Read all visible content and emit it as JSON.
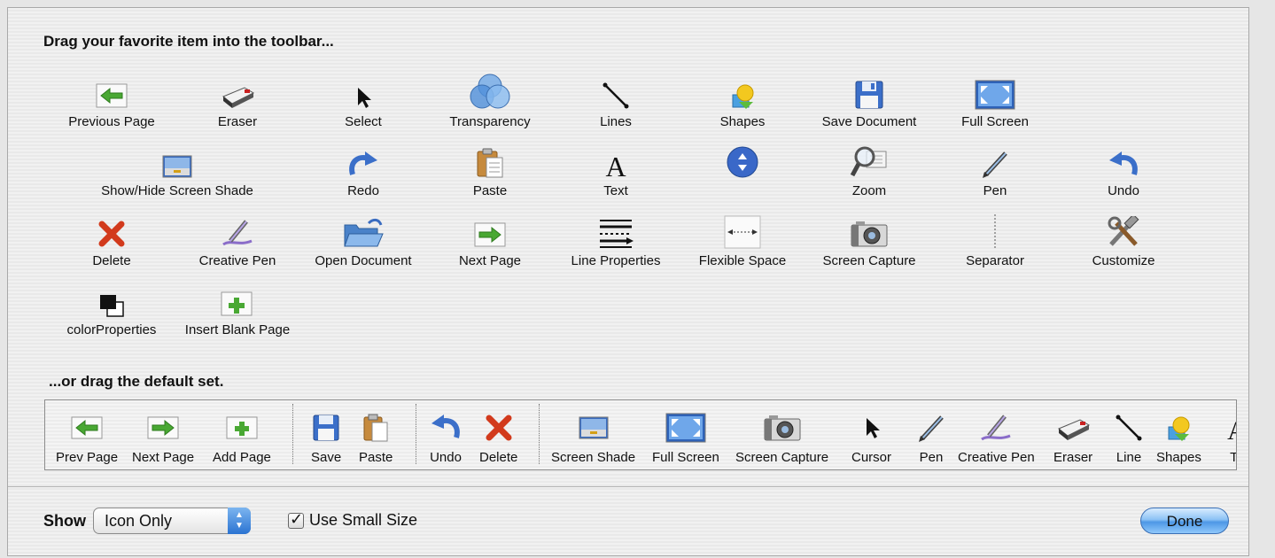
{
  "header": "Drag your favorite item into the toolbar...",
  "items": [
    {
      "label": "Previous Page",
      "icon": "previous-page-icon"
    },
    {
      "label": "Eraser",
      "icon": "eraser-icon"
    },
    {
      "label": "Select",
      "icon": "select-arrow-icon"
    },
    {
      "label": "Transparency",
      "icon": "transparency-icon"
    },
    {
      "label": "Lines",
      "icon": "line-icon"
    },
    {
      "label": "Shapes",
      "icon": "shapes-icon"
    },
    {
      "label": "Save Document",
      "icon": "save-icon"
    },
    {
      "label": "Full Screen",
      "icon": "full-screen-icon"
    },
    {
      "label": "Show/Hide Screen Shade",
      "icon": "screen-shade-icon"
    },
    {
      "label": "Redo",
      "icon": "redo-icon"
    },
    {
      "label": "Paste",
      "icon": "paste-icon"
    },
    {
      "label": "Text",
      "icon": "text-icon"
    },
    {
      "label": "",
      "icon": "scroll-arrows-icon"
    },
    {
      "label": "Zoom",
      "icon": "zoom-icon"
    },
    {
      "label": "Pen",
      "icon": "pen-icon"
    },
    {
      "label": "Undo",
      "icon": "undo-icon"
    },
    {
      "label": "Delete",
      "icon": "delete-icon"
    },
    {
      "label": "Creative Pen",
      "icon": "creative-pen-icon"
    },
    {
      "label": "Open Document",
      "icon": "open-folder-icon"
    },
    {
      "label": "Next Page",
      "icon": "next-page-icon"
    },
    {
      "label": "Line Properties",
      "icon": "line-properties-icon"
    },
    {
      "label": "Flexible Space",
      "icon": "flexible-space-icon"
    },
    {
      "label": "Screen Capture",
      "icon": "camera-icon"
    },
    {
      "label": "Separator",
      "icon": "separator-icon"
    },
    {
      "label": "Customize",
      "icon": "customize-tools-icon"
    },
    {
      "label": "colorProperties",
      "icon": "color-properties-icon"
    },
    {
      "label": "Insert Blank Page",
      "icon": "insert-blank-page-icon"
    }
  ],
  "default_header": "...or drag the default set.",
  "default_set": [
    {
      "label": "Prev Page",
      "icon": "previous-page-icon"
    },
    {
      "label": "Next Page",
      "icon": "next-page-icon"
    },
    {
      "label": "Add Page",
      "icon": "insert-blank-page-icon"
    },
    {
      "label": "Save",
      "icon": "save-icon"
    },
    {
      "label": "Paste",
      "icon": "paste-icon"
    },
    {
      "label": "Undo",
      "icon": "undo-icon"
    },
    {
      "label": "Delete",
      "icon": "delete-icon"
    },
    {
      "label": "Screen Shade",
      "icon": "screen-shade-icon"
    },
    {
      "label": "Full Screen",
      "icon": "full-screen-icon"
    },
    {
      "label": "Screen Capture",
      "icon": "camera-icon"
    },
    {
      "label": "Cursor",
      "icon": "select-arrow-icon"
    },
    {
      "label": "Pen",
      "icon": "pen-icon"
    },
    {
      "label": "Creative Pen",
      "icon": "creative-pen-icon"
    },
    {
      "label": "Eraser",
      "icon": "eraser-icon"
    },
    {
      "label": "Line",
      "icon": "line-icon"
    },
    {
      "label": "Shapes",
      "icon": "shapes-icon"
    },
    {
      "label": "Te",
      "icon": "text-icon"
    }
  ],
  "footer": {
    "show_label": "Show",
    "show_value": "Icon Only",
    "small_size_label": "Use Small Size",
    "small_size_checked": true,
    "done_label": "Done"
  }
}
